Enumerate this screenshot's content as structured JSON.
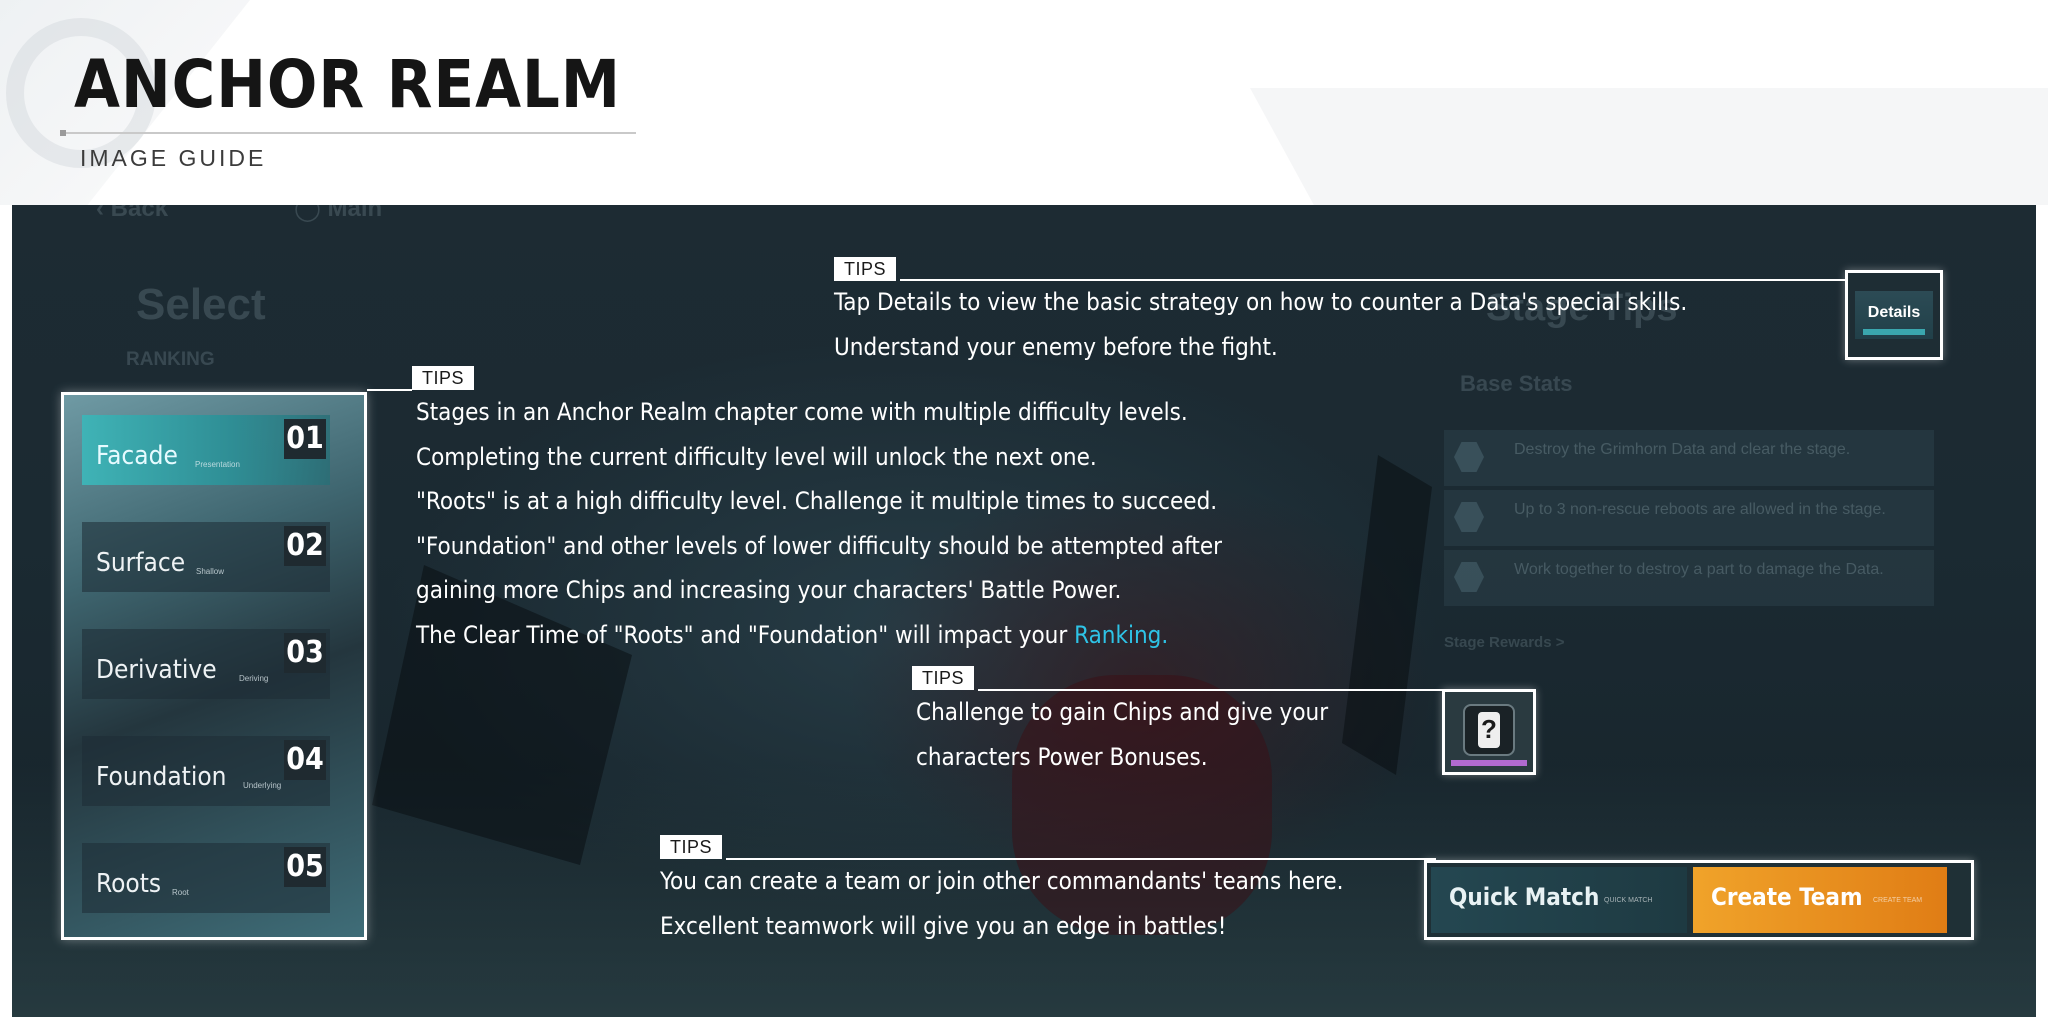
{
  "header": {
    "title": "ANCHOR REALM",
    "subtitle": "IMAGE GUIDE"
  },
  "scene": {
    "back_label": "Back",
    "back_side": "Main",
    "select_label": "Select",
    "ranking_label": "RANKING",
    "stage_tips_label": "Stage Tips",
    "base_stats_label": "Base Stats",
    "base_stats_rows": [
      "Destroy the Grimhorn Data and clear the stage.",
      "Up to 3 non-rescue reboots are allowed in the stage.",
      "Work together to destroy a part to damage the Data."
    ],
    "stage_rewards_label": "Stage Rewards >"
  },
  "difficulties": [
    {
      "label": "Facade",
      "sub": "Presentation",
      "number": "01",
      "active": true
    },
    {
      "label": "Surface",
      "sub": "Shallow",
      "number": "02",
      "active": false
    },
    {
      "label": "Derivative",
      "sub": "Deriving",
      "number": "03",
      "active": false
    },
    {
      "label": "Foundation",
      "sub": "Underlying",
      "number": "04",
      "active": false
    },
    {
      "label": "Roots",
      "sub": "Root",
      "number": "05",
      "active": false
    }
  ],
  "tips": {
    "tag": "TIPS",
    "details": {
      "lines": [
        "Tap Details to view the basic strategy on how to counter a Data's special skills.",
        "Understand your enemy before the fight."
      ],
      "button_label": "Details"
    },
    "difficulty": {
      "lines": [
        "Stages in an Anchor Realm chapter come with multiple difficulty levels.",
        "Completing the current difficulty level will unlock the next one.",
        "\"Roots\" is at a high difficulty level. Challenge it multiple times to succeed.",
        "\"Foundation\" and other levels of lower difficulty should be attempted after",
        "gaining more Chips and increasing your characters' Battle Power."
      ],
      "last_line_prefix": "The Clear Time of \"Roots\" and \"Foundation\" will impact your ",
      "last_line_highlight": "Ranking."
    },
    "chips": {
      "lines": [
        "Challenge to gain Chips and give your",
        "characters Power Bonuses."
      ],
      "icon_glyph": "?"
    },
    "team": {
      "lines": [
        "You can create a team or join other commandants' teams here.",
        "Excellent teamwork will give you an edge in battles!"
      ],
      "quick_match_label": "Quick Match",
      "quick_match_sub": "QUICK MATCH",
      "create_team_label": "Create Team",
      "create_team_sub": "CREATE TEAM"
    }
  },
  "colors": {
    "highlight": "#2ec3e6",
    "create_team": "#f0a32a",
    "active_difficulty": "#3fb3b6"
  }
}
